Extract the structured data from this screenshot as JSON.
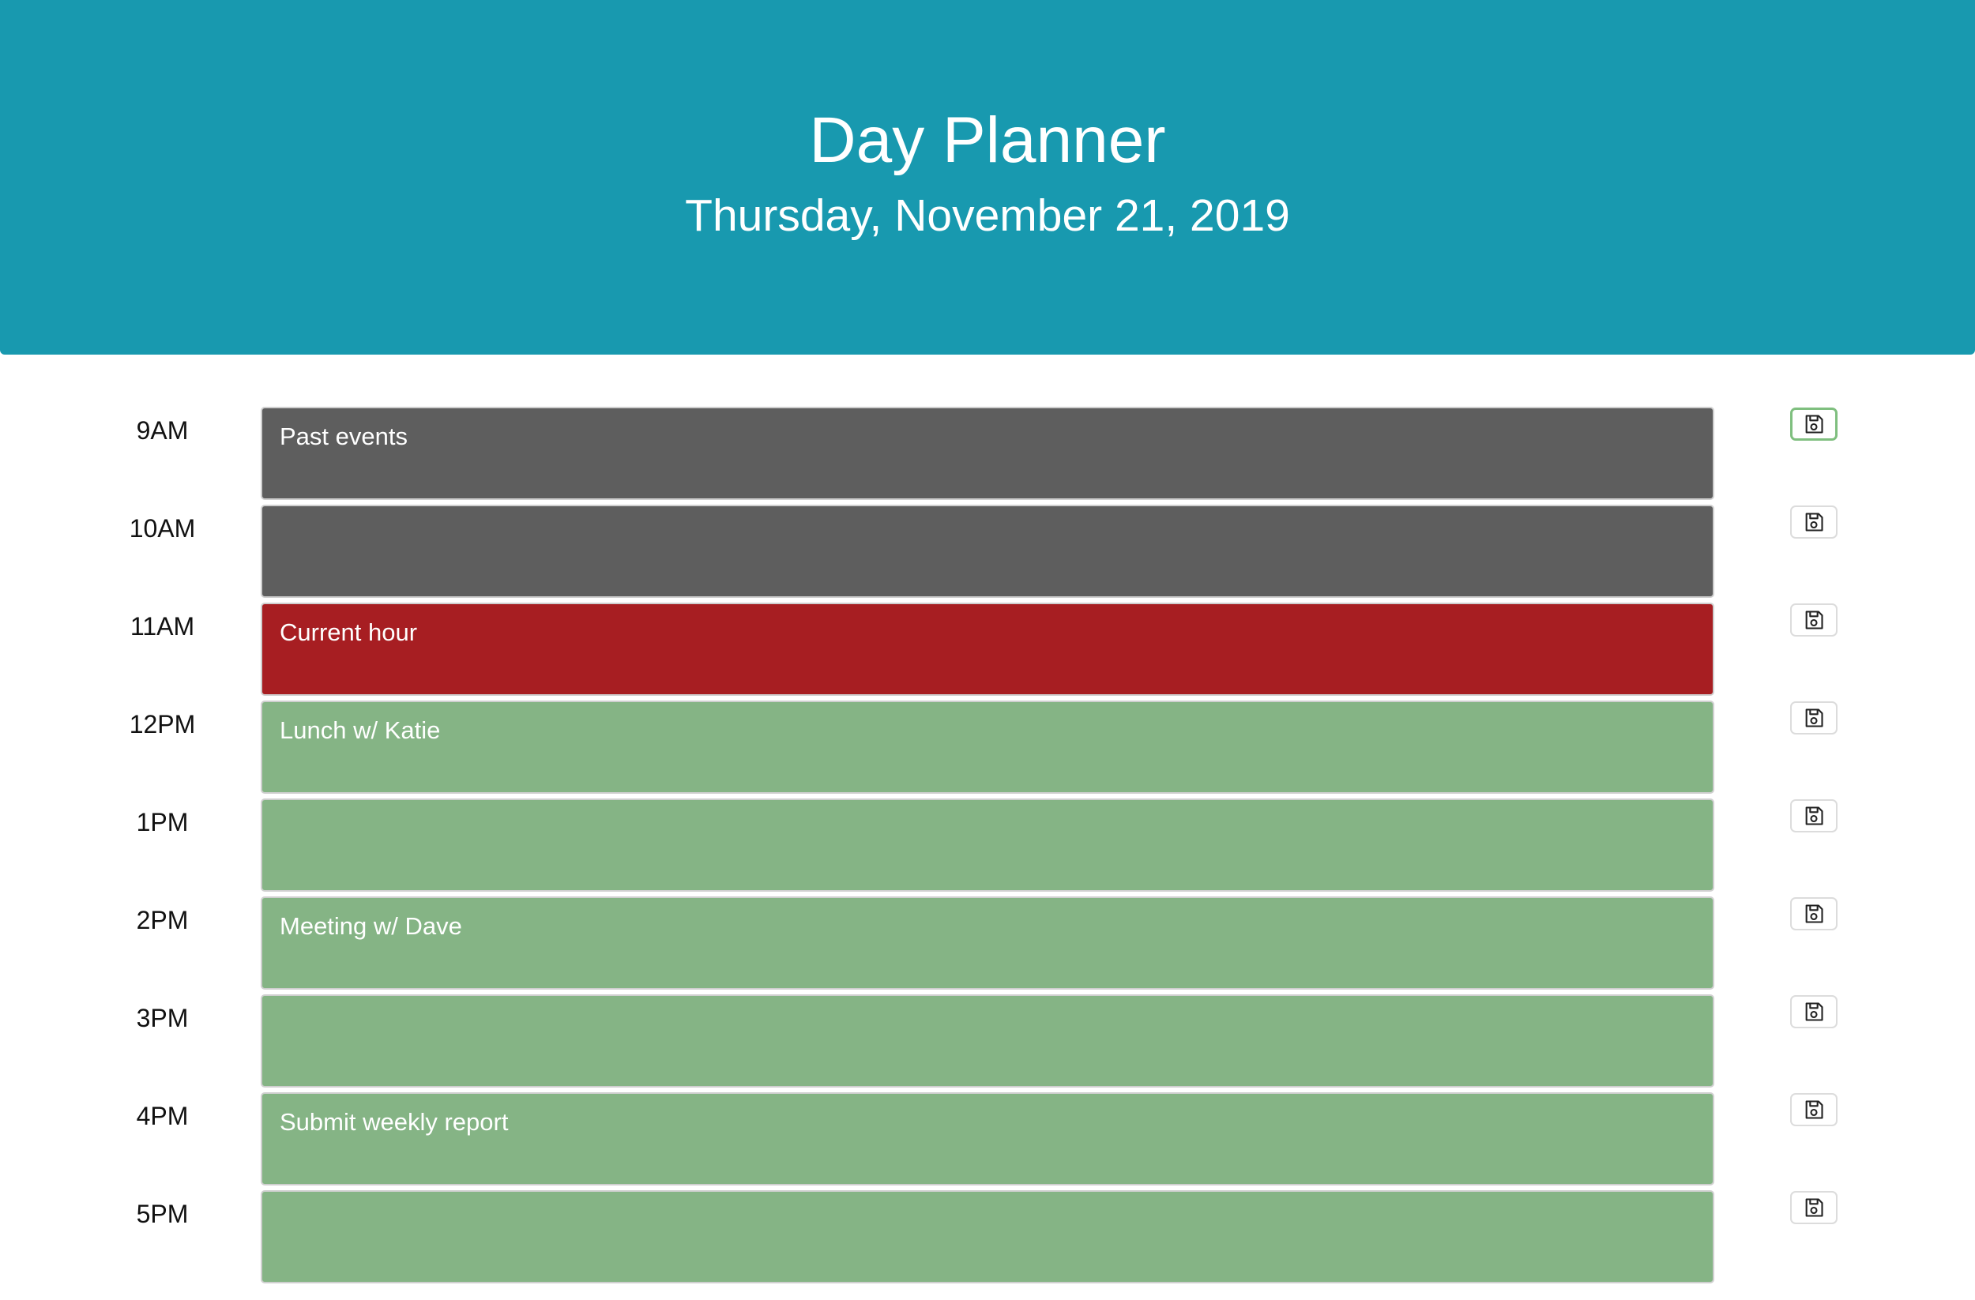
{
  "header": {
    "title": "Day Planner",
    "date": "Thursday, November 21, 2019"
  },
  "colors": {
    "header_bg": "#1899af",
    "past": "#5e5e5e",
    "present": "#a71e22",
    "future": "#85b485"
  },
  "rows": [
    {
      "hour": "9AM",
      "event": "Past events",
      "state": "past"
    },
    {
      "hour": "10AM",
      "event": "",
      "state": "past"
    },
    {
      "hour": "11AM",
      "event": "Current hour",
      "state": "present"
    },
    {
      "hour": "12PM",
      "event": "Lunch w/ Katie",
      "state": "future"
    },
    {
      "hour": "1PM",
      "event": "",
      "state": "future"
    },
    {
      "hour": "2PM",
      "event": "Meeting w/ Dave",
      "state": "future"
    },
    {
      "hour": "3PM",
      "event": "",
      "state": "future"
    },
    {
      "hour": "4PM",
      "event": "Submit weekly report",
      "state": "future"
    },
    {
      "hour": "5PM",
      "event": "",
      "state": "future"
    }
  ],
  "save_icon": "floppy-disk-icon"
}
